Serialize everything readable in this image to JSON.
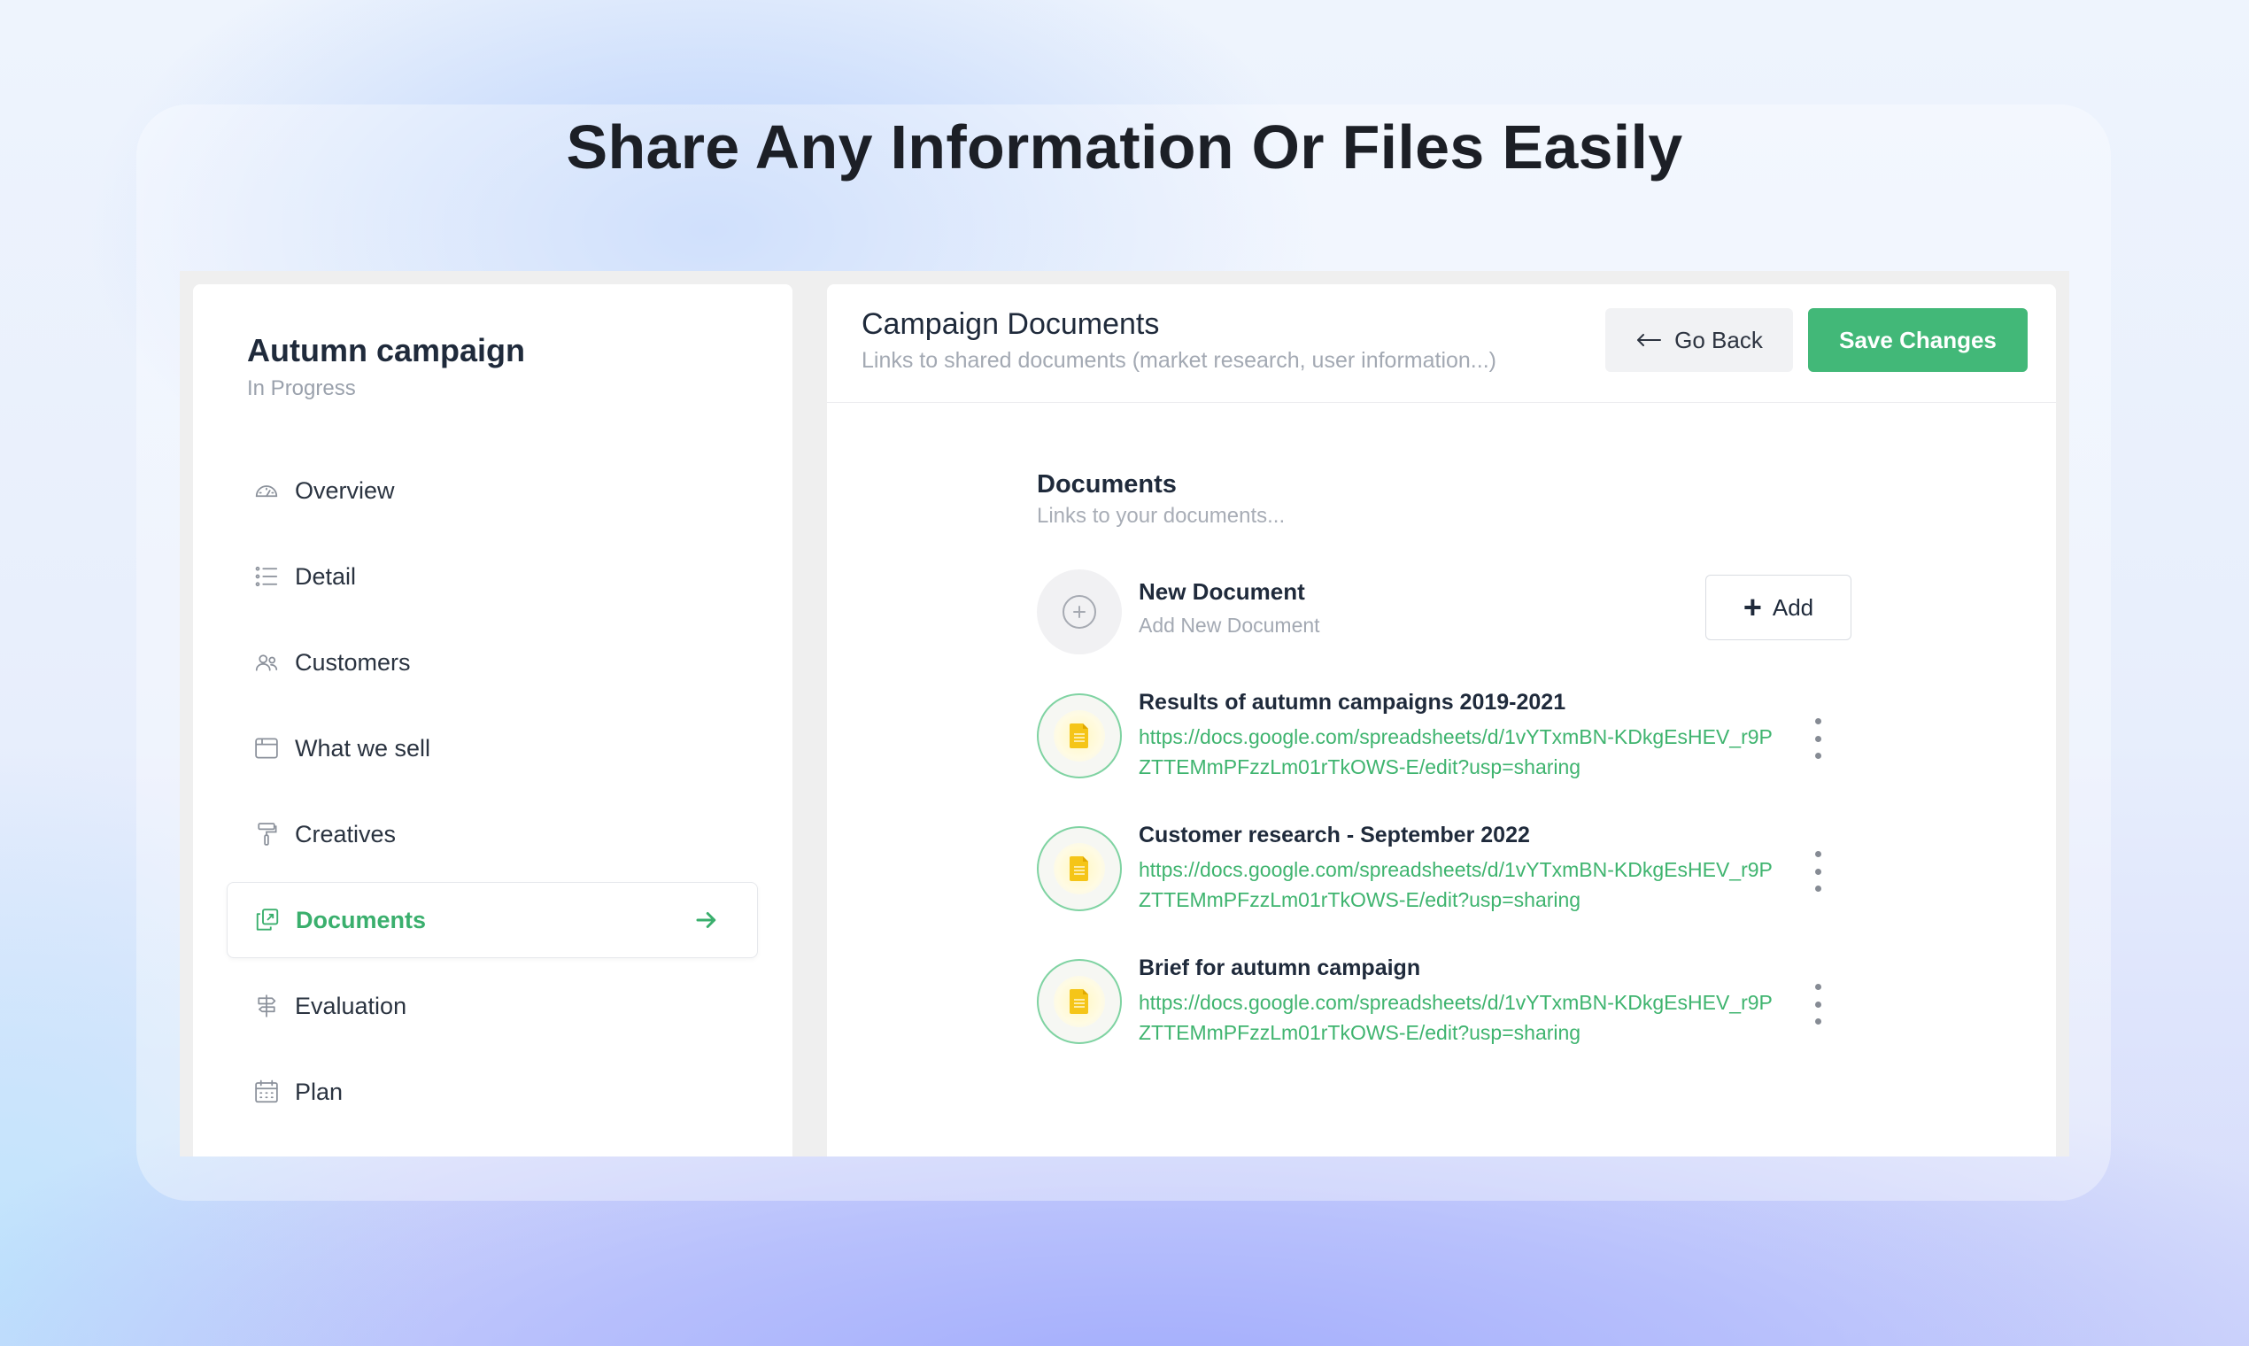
{
  "headline": "Share Any Information Or Files Easily",
  "sidebar": {
    "project_title": "Autumn campaign",
    "project_status": "In Progress",
    "items": [
      {
        "label": "Overview",
        "icon": "gauge-icon"
      },
      {
        "label": "Detail",
        "icon": "list-icon"
      },
      {
        "label": "Customers",
        "icon": "users-icon"
      },
      {
        "label": "What we sell",
        "icon": "browser-window-icon"
      },
      {
        "label": "Creatives",
        "icon": "paint-roller-icon"
      },
      {
        "label": "Documents",
        "icon": "documents-icon",
        "active": true
      },
      {
        "label": "Evaluation",
        "icon": "signpost-icon"
      },
      {
        "label": "Plan",
        "icon": "calendar-icon"
      }
    ]
  },
  "main": {
    "title": "Campaign Documents",
    "subtitle": "Links to shared documents (market research, user information...)",
    "go_back_label": "Go Back",
    "save_label": "Save Changes",
    "section_title": "Documents",
    "section_subtitle": "Links to your documents...",
    "new_document": {
      "title": "New Document",
      "subtitle": "Add New Document",
      "add_label": "Add"
    },
    "documents": [
      {
        "name": "Results of autumn campaigns 2019-2021",
        "url": "https://docs.google.com/spreadsheets/d/1vYTxmBN-KDkgEsHEV_r9PZTTEMmPFzzLm01rTkOWS-E/edit?usp=sharing"
      },
      {
        "name": "Customer research - September 2022",
        "url": "https://docs.google.com/spreadsheets/d/1vYTxmBN-KDkgEsHEV_r9PZTTEMmPFzzLm01rTkOWS-E/edit?usp=sharing"
      },
      {
        "name": "Brief for autumn campaign",
        "url": "https://docs.google.com/spreadsheets/d/1vYTxmBN-KDkgEsHEV_r9PZTTEMmPFzzLm01rTkOWS-E/edit?usp=sharing"
      }
    ]
  },
  "colors": {
    "accent_green": "#42b878",
    "link_green": "#3fb46f",
    "text_dark": "#1f2a3b",
    "text_muted": "#a3a9b3",
    "doc_yellow": "#f5c518"
  }
}
